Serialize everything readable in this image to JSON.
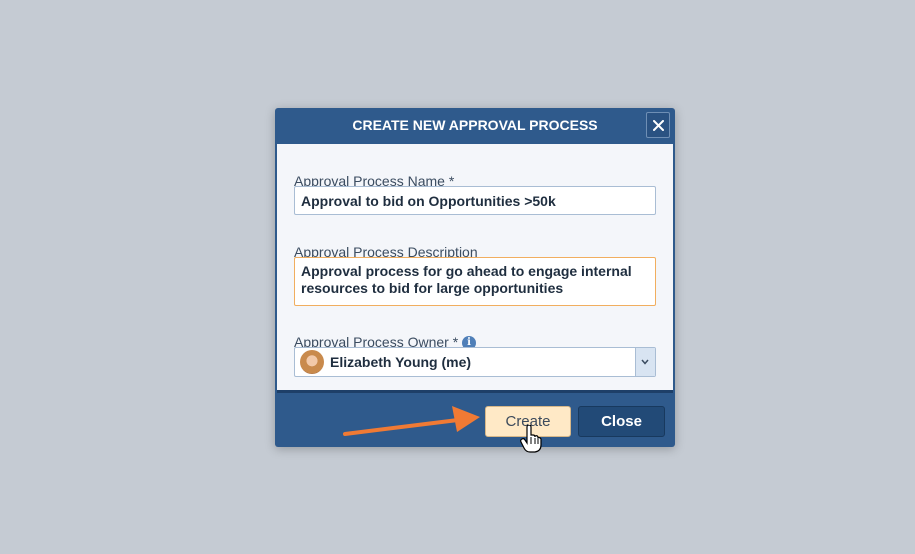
{
  "dialog": {
    "title": "CREATE NEW APPROVAL PROCESS",
    "close_icon": "close-icon",
    "fields": {
      "name": {
        "label": "Approval Process Name *",
        "value": "Approval to bid on Opportunities >50k"
      },
      "description": {
        "label": "Approval Process Description",
        "value": "Approval process for go ahead to engage internal resources to bid for large opportunities"
      },
      "owner": {
        "label": "Approval Process Owner *",
        "info_icon": "info-icon",
        "info_glyph": "i",
        "selected": "Elizabeth Young (me)"
      }
    },
    "buttons": {
      "create": "Create",
      "close": "Close"
    }
  },
  "colors": {
    "header": "#2f5a8c",
    "accent_border": "#f1ae5f",
    "create_button": "#ffe9c6",
    "close_button": "#224a77",
    "annotation_arrow": "#f07a34"
  }
}
